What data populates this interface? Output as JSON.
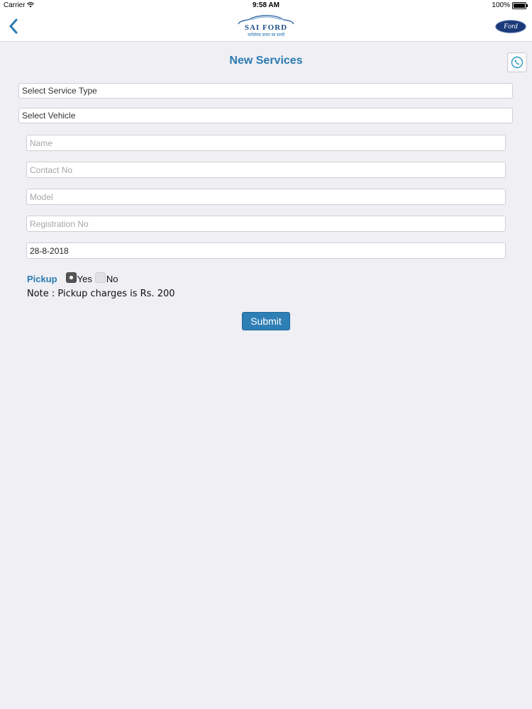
{
  "status_bar": {
    "carrier": "Carrier",
    "time": "9:58 AM",
    "battery": "100%"
  },
  "nav": {
    "logo_brand": "SAI FORD",
    "logo_tagline": "भरोसेमंद सफर का साथी",
    "ford_logo_text": "Ford"
  },
  "page": {
    "title": "New Services"
  },
  "form": {
    "service_type_select": "Select Service Type",
    "vehicle_select": "Select Vehicle",
    "name_placeholder": "Name",
    "contact_placeholder": "Contact No",
    "model_placeholder": "Model",
    "registration_placeholder": "Registration No",
    "date_value": "28-8-2018",
    "pickup_label": "Pickup",
    "pickup_yes": "Yes",
    "pickup_no": "No",
    "pickup_selected": "Yes",
    "note": "Note : Pickup charges is Rs. 200",
    "submit_label": "Submit"
  },
  "colors": {
    "accent": "#2a7ab0",
    "button": "#2d7fb5",
    "background": "#efeff4"
  }
}
